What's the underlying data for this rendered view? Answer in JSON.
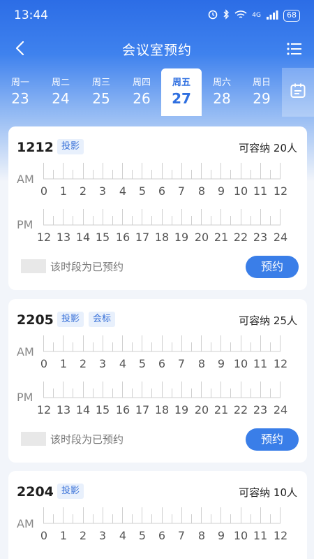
{
  "status": {
    "time": "13:44",
    "battery": "68",
    "network": "4G"
  },
  "nav": {
    "title": "会议室预约"
  },
  "week": [
    {
      "name": "周一",
      "num": "23",
      "selected": false
    },
    {
      "name": "周二",
      "num": "24",
      "selected": false
    },
    {
      "name": "周三",
      "num": "25",
      "selected": false
    },
    {
      "name": "周四",
      "num": "26",
      "selected": false
    },
    {
      "name": "周五",
      "num": "27",
      "selected": true
    },
    {
      "name": "周六",
      "num": "28",
      "selected": false
    },
    {
      "name": "周日",
      "num": "29",
      "selected": false
    }
  ],
  "labels": {
    "am": "AM",
    "pm": "PM",
    "am_ticks": [
      "0",
      "1",
      "2",
      "3",
      "4",
      "5",
      "6",
      "7",
      "8",
      "9",
      "10",
      "11",
      "12"
    ],
    "pm_ticks": [
      "12",
      "13",
      "14",
      "15",
      "16",
      "17",
      "18",
      "19",
      "20",
      "21",
      "22",
      "23",
      "24"
    ],
    "booked_legend": "该时段为已预约",
    "book_button": "预约"
  },
  "rooms": [
    {
      "number": "1212",
      "tags": [
        "投影"
      ],
      "capacity": "可容纳 20人"
    },
    {
      "number": "2205",
      "tags": [
        "投影",
        "会标"
      ],
      "capacity": "可容纳 25人"
    },
    {
      "number": "2204",
      "tags": [
        "投影"
      ],
      "capacity": "可容纳 10人"
    }
  ],
  "colors": {
    "primary": "#3a7ee8",
    "tag_bg": "#e8f0fc",
    "tag_text": "#3a72d8"
  }
}
